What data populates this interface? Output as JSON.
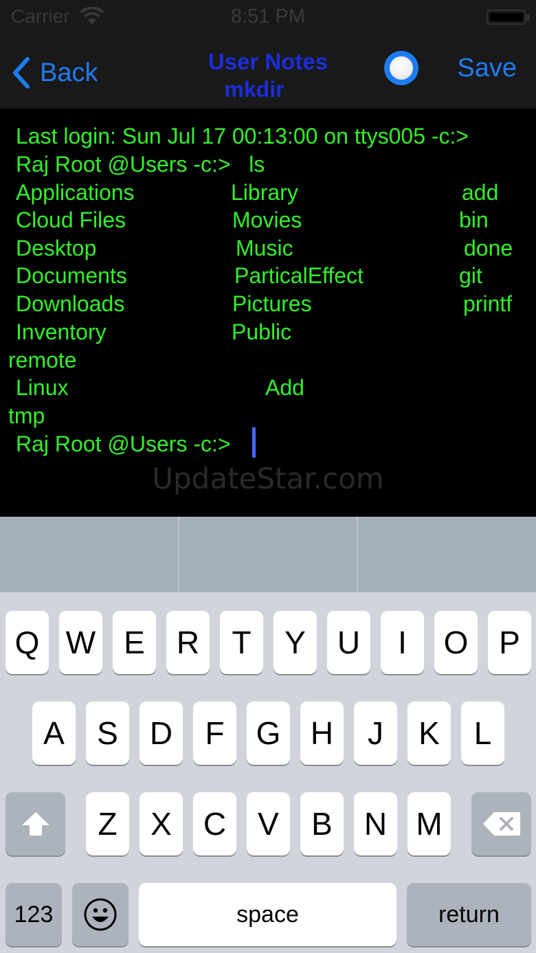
{
  "status_bar": {
    "carrier": "Carrier",
    "time": "8:51 PM"
  },
  "nav": {
    "back_label": "Back",
    "title": "User Notes",
    "subtitle": "mkdir",
    "save_label": "Save"
  },
  "terminal": {
    "lines": [
      "Last login: Sun Jul 17 00:13:00 on ttys005 -c:>",
      "Raj Root @Users -c:>   ls",
      "Applications",
      "Library",
      "add",
      "Cloud Files",
      "Movies",
      "bin",
      "Desktop",
      "Music",
      "done",
      "Documents",
      "ParticalEffect",
      "git",
      "Downloads",
      "Pictures",
      "printf",
      "Inventory",
      "Public",
      "remote",
      "Linux",
      "Add",
      "tmp",
      "Raj Root @Users -c:>"
    ],
    "watermark": "UpdateStar.com"
  },
  "keyboard": {
    "row1": [
      "Q",
      "W",
      "E",
      "R",
      "T",
      "Y",
      "U",
      "I",
      "O",
      "P"
    ],
    "row2": [
      "A",
      "S",
      "D",
      "F",
      "G",
      "H",
      "J",
      "K",
      "L"
    ],
    "row3": [
      "Z",
      "X",
      "C",
      "V",
      "B",
      "N",
      "M"
    ],
    "numbers_label": "123",
    "space_label": "space",
    "return_label": "return",
    "shift_icon": "shift-icon",
    "delete_icon": "delete-icon",
    "emoji_icon": "emoji-icon"
  }
}
